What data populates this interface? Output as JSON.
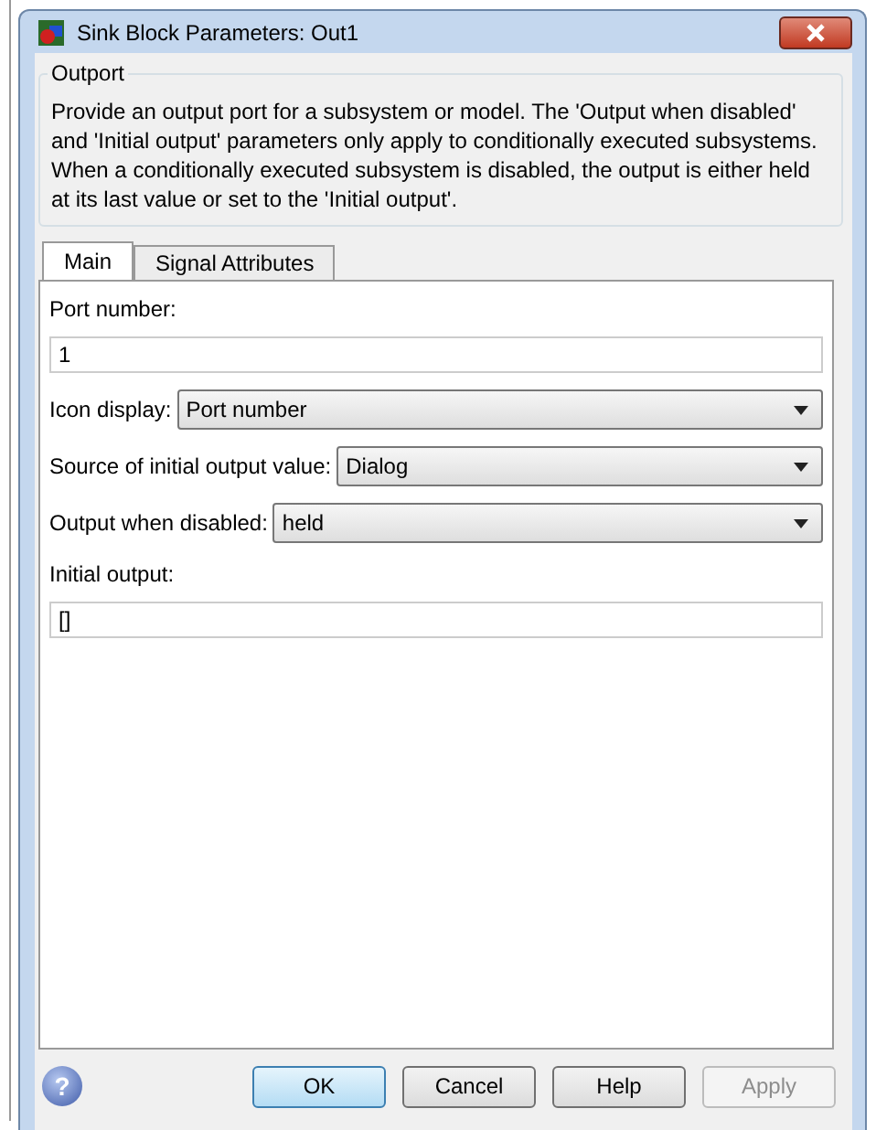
{
  "window": {
    "title": "Sink Block Parameters: Out1"
  },
  "group": {
    "title": "Outport",
    "description": "Provide an output port for a subsystem or model.  The 'Output when disabled' and 'Initial output' parameters only apply to conditionally executed subsystems. When a conditionally executed subsystem is disabled, the output is either held at its last value or set to the 'Initial output'."
  },
  "tabs": [
    {
      "label": "Main",
      "selected": true
    },
    {
      "label": "Signal Attributes",
      "selected": false
    }
  ],
  "fields": [
    {
      "kind": "text",
      "label": "Port number:",
      "value": "1"
    },
    {
      "kind": "dropdown",
      "label": "Icon display:",
      "value": "Port number"
    },
    {
      "kind": "dropdown",
      "label": "Source of initial output value:",
      "value": "Dialog"
    },
    {
      "kind": "dropdown",
      "label": "Output when disabled:",
      "value": "held"
    },
    {
      "kind": "text",
      "label": "Initial output:",
      "value": "[]"
    }
  ],
  "help_icon": "?",
  "buttons": [
    {
      "label": "OK",
      "default": true,
      "disabled": false
    },
    {
      "label": "Cancel",
      "default": false,
      "disabled": false
    },
    {
      "label": "Help",
      "default": false,
      "disabled": false
    },
    {
      "label": "Apply",
      "default": false,
      "disabled": true
    }
  ]
}
